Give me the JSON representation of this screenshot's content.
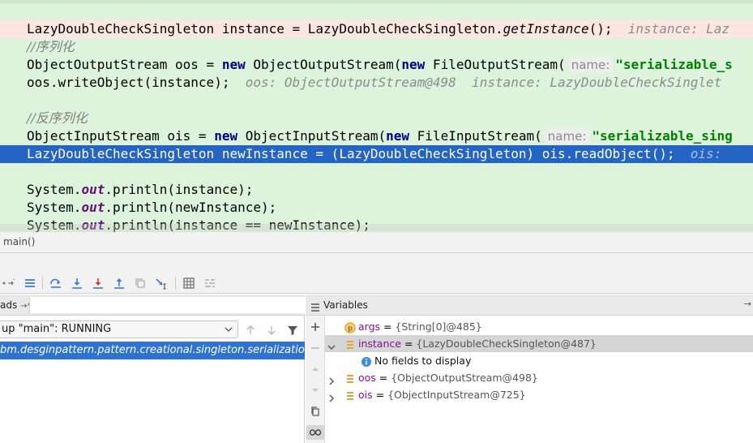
{
  "editor": {
    "lines": [
      {
        "pre": "LazyDoubleCheckSingleton instance = LazyDoubleCheckSingleton.",
        "meth": "getInstance",
        "post": "();",
        "hint": "instance: Laz"
      },
      {
        "comment": "//序列化"
      },
      {
        "pre": "ObjectOutputStream oos = ",
        "kw1": "new",
        "mid1": " ObjectOutputStream(",
        "kw2": "new",
        "mid2": " FileOutputStream(",
        "pname": "name:",
        "str": "\"serializable_s"
      },
      {
        "pre": "oos.writeObject(instance);",
        "hint": "oos: ObjectOutputStream@498  instance: LazyDoubleCheckSinglet"
      },
      {
        "comment": "//反序列化"
      },
      {
        "pre": "ObjectInputStream ois = ",
        "kw1": "new",
        "mid1": " ObjectInputStream(",
        "kw2": "new",
        "mid2": " FileInputStream(",
        "pname": "name:",
        "str": "\"serializable_sing"
      },
      {
        "pre": "LazyDoubleCheckSingleton newInstance = (LazyDoubleCheckSingleton) ois.readObject();",
        "hint": "ois:"
      },
      {
        "a": "System.",
        "f": "out",
        "b": ".println(instance);"
      },
      {
        "a": "System.",
        "f": "out",
        "b": ".println(newInstance);"
      },
      {
        "a": "System.",
        "f": "out",
        "b": ".println(instance == newInstance);"
      }
    ]
  },
  "breadcrumb": "main()",
  "frames": {
    "header": "ads",
    "header_pin": "→*",
    "thread_value": "up \"main\": RUNNING",
    "frame_item": "bm.desginpattern.pattern.creational.singleton.serialization)"
  },
  "variables": {
    "title": "Variables",
    "pin": "→",
    "rows": [
      {
        "icon": "param",
        "name": "args",
        "eq": " = ",
        "value": "{String[0]@485}",
        "expandable": false
      },
      {
        "icon": "field",
        "name": "instance",
        "eq": " = ",
        "value": "{LazyDoubleCheckSingleton@487}",
        "expandable": true,
        "expanded": true
      },
      {
        "icon": "info",
        "note": "No fields to display"
      },
      {
        "icon": "field",
        "name": "oos",
        "eq": " = ",
        "value": "{ObjectOutputStream@498}",
        "expandable": true,
        "expanded": false
      },
      {
        "icon": "field",
        "name": "ois",
        "eq": " = ",
        "value": "{ObjectInputStream@725}",
        "expandable": true,
        "expanded": false
      }
    ]
  },
  "colors": {
    "editor_bg": "#ddf3dc",
    "execution_line": "#2464c4",
    "error_line": "#fbe6e2",
    "selected_frame": "#2f73d0",
    "keyword": "#000080",
    "string": "#008000"
  }
}
